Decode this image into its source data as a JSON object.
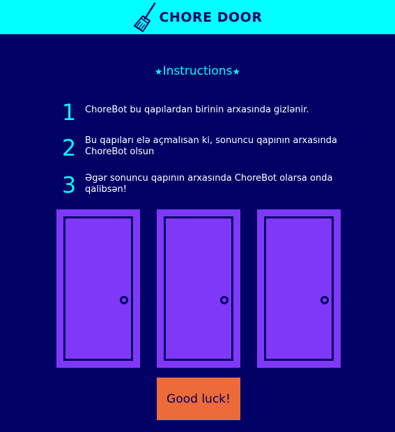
{
  "header": {
    "title": "CHORE DOOR",
    "logo_icon": "broom-icon"
  },
  "instructions": {
    "heading": "Instructions",
    "star": "★",
    "steps": [
      {
        "number": "1",
        "text": "ChoreBot bu qapılardan birinin arxasında gizlənir."
      },
      {
        "number": "2",
        "text": "Bu qapıları elə açmalısan ki, sonuncu qapının arxasında ChoreBot olsun"
      },
      {
        "number": "3",
        "text": "Əgər sonuncu qapının arxasında ChoreBot olarsa onda qalibsən!"
      }
    ]
  },
  "doors": {
    "count": 3,
    "icon": "door-icon"
  },
  "start_button": {
    "label": "Good luck!"
  },
  "colors": {
    "background": "#010165",
    "header": "#00ffff",
    "accent": "#00ffff",
    "door": "#8038f8",
    "button": "#ed6a39"
  }
}
